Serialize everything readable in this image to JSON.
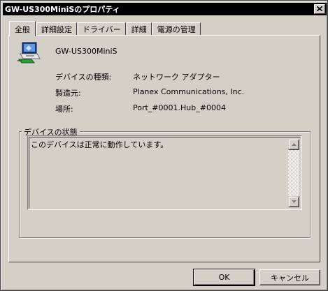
{
  "window": {
    "title": "GW-US300MiniSのプロパティ"
  },
  "tabs": [
    {
      "label": "全般",
      "active": true
    },
    {
      "label": "詳細設定",
      "active": false
    },
    {
      "label": "ドライバー",
      "active": false
    },
    {
      "label": "詳細",
      "active": false
    },
    {
      "label": "電源の管理",
      "active": false
    }
  ],
  "device": {
    "icon": "network-adapter-icon",
    "name": "GW-US300MiniS",
    "properties": [
      {
        "label": "デバイスの種類:",
        "value": "ネットワーク アダプター"
      },
      {
        "label": "製造元:",
        "value": "Planex Communications, Inc."
      },
      {
        "label": "場所:",
        "value": "Port_#0001.Hub_#0004"
      }
    ]
  },
  "status": {
    "group_title": "デバイスの状態",
    "text": "このデバイスは正常に動作しています。"
  },
  "buttons": {
    "ok": "OK",
    "cancel": "キャンセル"
  },
  "colors": {
    "face": "#d4d0c8",
    "title_bar": "#000000",
    "shadow": "#808080"
  }
}
